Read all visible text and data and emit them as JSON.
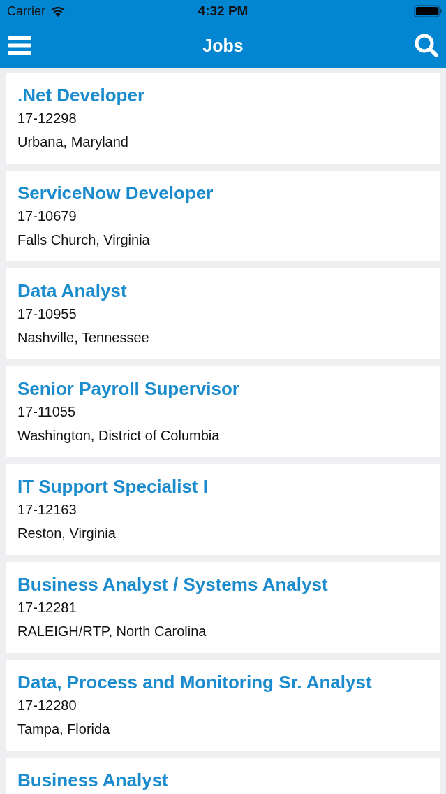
{
  "status_bar": {
    "carrier": "Carrier",
    "time": "4:32 PM"
  },
  "nav_bar": {
    "title": "Jobs"
  },
  "jobs": [
    {
      "title": ".Net Developer",
      "id": "17-12298",
      "location": "Urbana, Maryland"
    },
    {
      "title": "ServiceNow Developer",
      "id": "17-10679",
      "location": "Falls Church, Virginia"
    },
    {
      "title": "Data Analyst",
      "id": "17-10955",
      "location": "Nashville, Tennessee"
    },
    {
      "title": "Senior Payroll Supervisor",
      "id": "17-11055",
      "location": "Washington, District of Columbia"
    },
    {
      "title": "IT Support Specialist I",
      "id": "17-12163",
      "location": "Reston, Virginia"
    },
    {
      "title": "Business Analyst / Systems Analyst",
      "id": "17-12281",
      "location": "RALEIGH/RTP, North Carolina"
    },
    {
      "title": "Data, Process and Monitoring Sr. Analyst",
      "id": "17-12280",
      "location": "Tampa, Florida"
    },
    {
      "title": "Business Analyst"
    }
  ]
}
